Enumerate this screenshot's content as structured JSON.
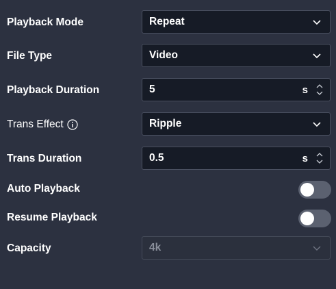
{
  "settings": {
    "playback_mode": {
      "label": "Playback Mode",
      "value": "Repeat",
      "icon": "chevron-down-icon"
    },
    "file_type": {
      "label": "File Type",
      "value": "Video",
      "icon": "chevron-down-icon"
    },
    "playback_duration": {
      "label": "Playback Duration",
      "value": "5",
      "unit": "s",
      "icon": "stepper-arrows-icon"
    },
    "trans_effect": {
      "label": "Trans Effect",
      "value": "Ripple",
      "info_icon": "info-icon",
      "icon": "chevron-down-icon"
    },
    "trans_duration": {
      "label": "Trans Duration",
      "value": "0.5",
      "unit": "s",
      "icon": "stepper-arrows-icon"
    },
    "auto_playback": {
      "label": "Auto Playback",
      "enabled": false
    },
    "resume_playback": {
      "label": "Resume Playback",
      "enabled": false
    },
    "capacity": {
      "label": "Capacity",
      "value": "4k",
      "disabled": true,
      "icon": "chevron-down-icon"
    }
  },
  "colors": {
    "background": "#2c3140",
    "field_background": "#161b26",
    "field_border": "#4a5060",
    "toggle_off": "#5b6170",
    "disabled_text": "#8a8f9b"
  }
}
